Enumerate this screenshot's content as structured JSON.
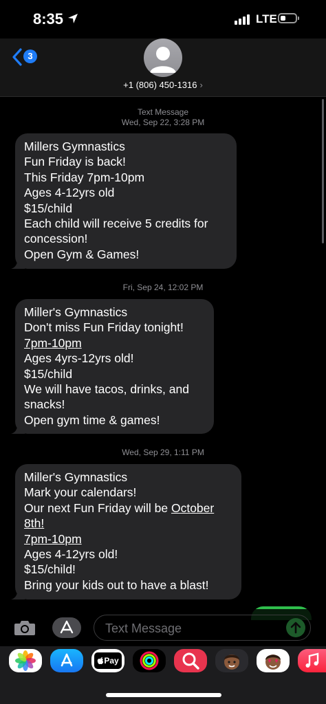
{
  "status_bar": {
    "time": "8:35",
    "network": "LTE"
  },
  "header": {
    "unread_count": "3",
    "contact": "+1 (806) 450-1316",
    "chevron": "›"
  },
  "thread": [
    {
      "kind": "timestamp",
      "label": "Text Message",
      "text": "Wed, Sep 22, 3:28 PM"
    },
    {
      "kind": "bubble",
      "lines": [
        "Millers Gymnastics",
        "Fun Friday is back!",
        "This Friday 7pm-10pm",
        "Ages 4-12yrs old",
        "$15/child",
        "Each child will receive 5 credits for",
        "concession!",
        "Open Gym & Games!"
      ]
    },
    {
      "kind": "timestamp",
      "label": "",
      "text": "Fri, Sep 24, 12:02 PM"
    },
    {
      "kind": "bubble",
      "lines": [
        "Miller's Gymnastics",
        "Don't miss Fun Friday tonight!",
        "7pm-10pm",
        "Ages 4yrs-12yrs old!",
        "$15/child",
        "We will have tacos, drinks, and",
        "snacks!",
        "Open gym time & games!"
      ]
    },
    {
      "kind": "timestamp",
      "label": "",
      "text": "Wed, Sep 29, 1:11 PM"
    },
    {
      "kind": "bubble",
      "lines": [
        "Miller's Gymnastics",
        "Mark your calendars!",
        "Our next Fun Friday will be ",
        "October",
        "8th!",
        "7pm-10pm",
        "Ages 4-12yrs old!",
        "$15/child!",
        "Bring your kids out to have a blast!"
      ]
    }
  ],
  "composer": {
    "placeholder": "Text Message"
  },
  "app_drawer": [
    {
      "name": "photos-icon",
      "text": ""
    },
    {
      "name": "app-store-icon",
      "text": ""
    },
    {
      "name": "apple-pay-icon",
      "text": "Pay"
    },
    {
      "name": "activity-icon",
      "text": ""
    },
    {
      "name": "search-images-icon",
      "text": ""
    },
    {
      "name": "memoji-icon",
      "text": ""
    },
    {
      "name": "memoji-stickers-icon",
      "text": ""
    },
    {
      "name": "music-icon",
      "text": ""
    }
  ],
  "colors": {
    "accent": "#1f7cf6",
    "bubble": "#262628",
    "send_green": "#2fbe4c"
  }
}
